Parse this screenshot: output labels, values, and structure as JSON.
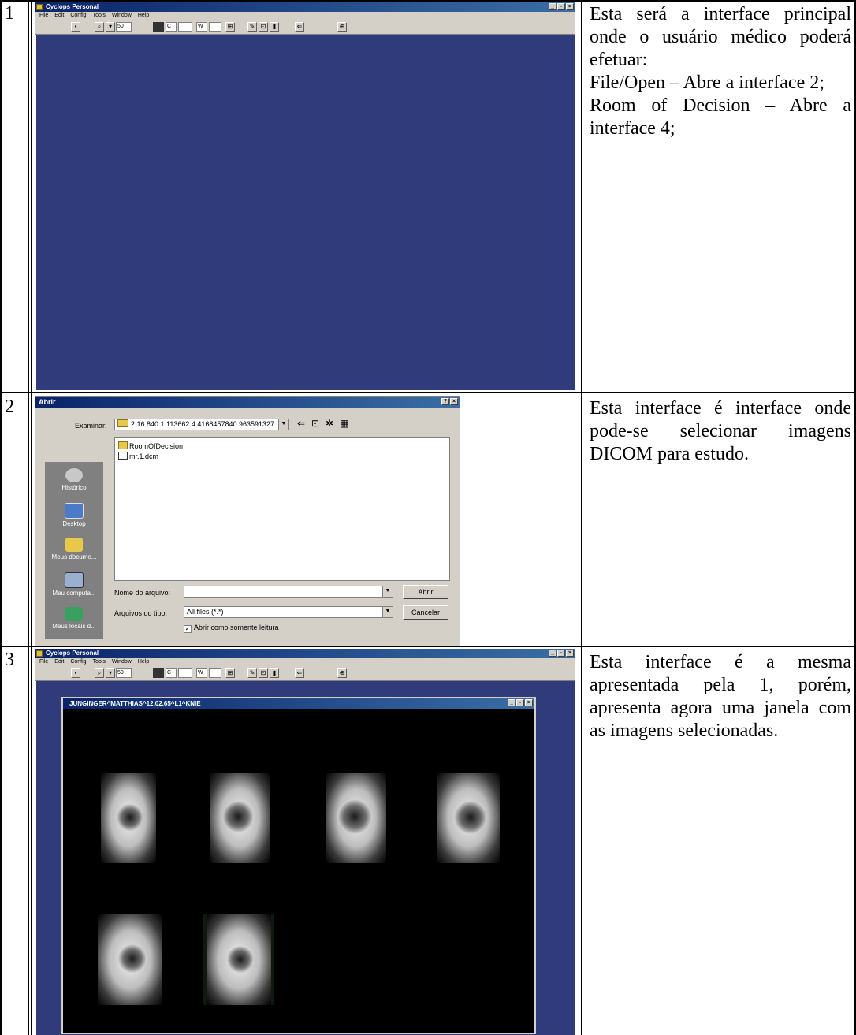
{
  "rows": [
    {
      "number": "1",
      "description": [
        "Esta será a interface principal onde o usuário médico poderá efetuar:",
        "File/Open – Abre a interface 2;",
        "Room of Decision – Abre a interface 4;"
      ]
    },
    {
      "number": "2",
      "description": [
        "Esta interface é interface onde pode-se selecionar imagens DICOM para estudo."
      ]
    },
    {
      "number": "3",
      "description": [
        "Esta interface é a mesma apresentada pela 1, porém, apresenta agora uma janela com as imagens selecionadas."
      ]
    }
  ],
  "app": {
    "title": "Cyclops Personal",
    "menu": [
      "File",
      "Edit",
      "Config",
      "Tools",
      "Window",
      "Help"
    ],
    "zoom_value": "50",
    "contrast_label": "C",
    "width_label": "W",
    "workspace_color": "#2f3b7a"
  },
  "open_dialog": {
    "title": "Abrir",
    "look_in_label": "Examinar:",
    "look_in_value": "2.16.840.1.113662.4.4168457840.963591327",
    "places": [
      "Histórico",
      "Desktop",
      "Meus docume...",
      "Meu computa...",
      "Meus locais d..."
    ],
    "files": [
      "RoomOfDecision",
      "mr.1.dcm"
    ],
    "filename_label": "Nome do arquivo:",
    "filename_value": "",
    "filetype_label": "Arquivos do tipo:",
    "filetype_value": "All files (*.*)",
    "open_button": "Abrir",
    "cancel_button": "Cancelar",
    "readonly_label": "Abrir como somente leitura",
    "readonly_checked": true
  },
  "image_window": {
    "title": "JUNGINGER^MATTHIAS^12.02.65^L1^KNIE",
    "image_count": 6
  }
}
